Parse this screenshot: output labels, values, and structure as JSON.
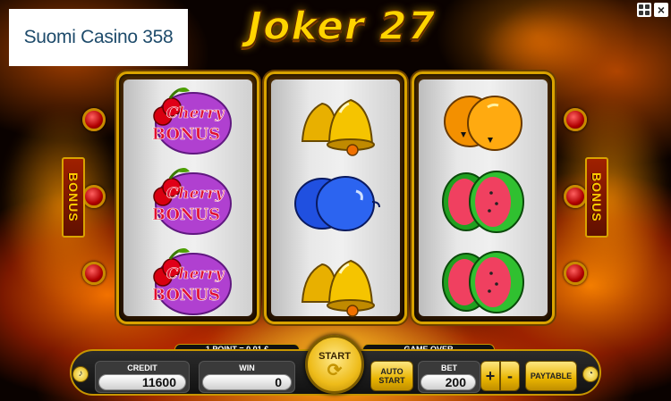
{
  "logo": {
    "text": "Suomi Casino 358"
  },
  "game": {
    "title": "Joker 27"
  },
  "window": {
    "fullscreen_icon": "fullscreen-icon",
    "close_icon": "close-icon"
  },
  "reels": [
    {
      "symbols": [
        "Cherry Bonus",
        "Cherry Bonus",
        "Cherry Bonus"
      ]
    },
    {
      "symbols": [
        "Bell",
        "Plum",
        "Bell"
      ]
    },
    {
      "symbols": [
        "Orange",
        "Watermelon",
        "Watermelon"
      ]
    }
  ],
  "bonus_tabs": {
    "left": "BONUS",
    "right": "BONUS"
  },
  "cherry_label": {
    "line1": "Cherry",
    "line2": "BONUS"
  },
  "controls": {
    "point_value": "1 POINT = 0.01 €",
    "status": "GAME OVER",
    "credit_label": "CREDIT",
    "credit_value": "11600",
    "win_label": "WIN",
    "win_value": "0",
    "start_label": "START",
    "autostart_line1": "AUTO",
    "autostart_line2": "START",
    "bet_label": "BET",
    "bet_value": "200",
    "plus_label": "+",
    "minus_label": "-",
    "paytable_label": "PAYTABLE",
    "sound_icon": "speaker-icon",
    "settings_icon": "gauge-icon"
  },
  "colors": {
    "accent_gold": "#e8b400",
    "title_yellow": "#ffd400",
    "logo_blue": "#1e4b6b"
  }
}
